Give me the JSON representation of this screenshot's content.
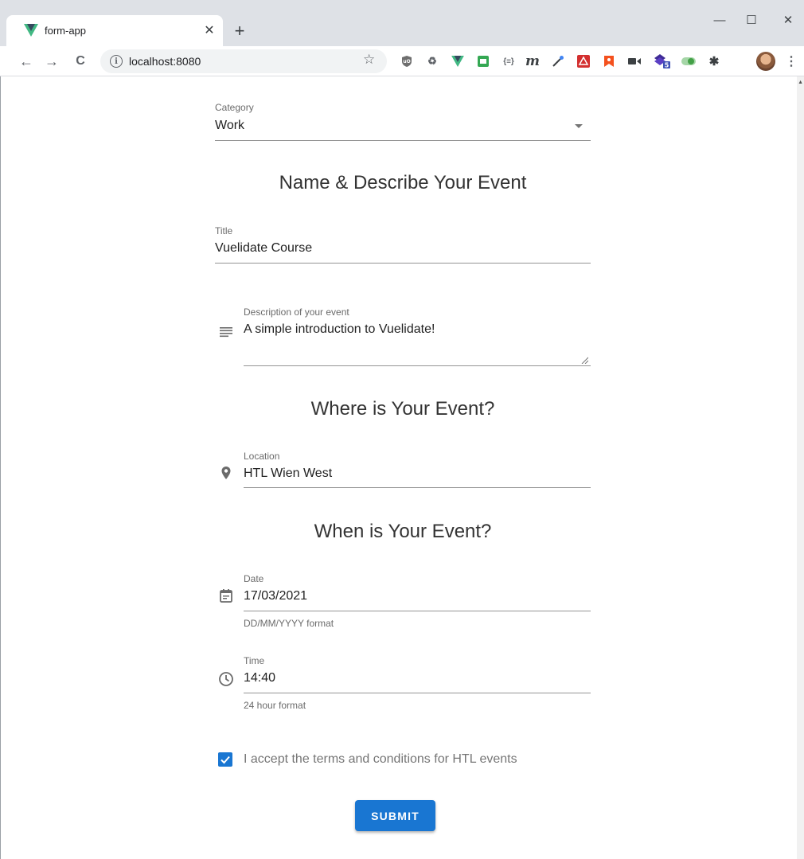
{
  "browser": {
    "tab_title": "form-app",
    "tab_close": "✕",
    "new_tab": "+",
    "minimize": "—",
    "maximize": "☐",
    "close": "✕",
    "back": "←",
    "forward": "→",
    "reload": "C",
    "url": "localhost:8080",
    "info_glyph": "i",
    "star": "☆",
    "menu": "⋮",
    "extension_icons": [
      "ublock-origin-icon",
      "recycle-icon",
      "vue-devtools-icon",
      "printer-icon",
      "json-icon",
      "m-icon",
      "eyedropper-icon",
      "acrobat-icon",
      "bookmark-icon",
      "video-icon",
      "stack-icon",
      "toggle-icon",
      "puzzle-icon"
    ]
  },
  "form": {
    "category": {
      "label": "Category",
      "value": "Work"
    },
    "section_name": "Name & Describe Your Event",
    "title": {
      "label": "Title",
      "value": "Vuelidate Course"
    },
    "description": {
      "label": "Description of your event",
      "value": "A simple introduction to Vuelidate!"
    },
    "section_where": "Where is Your Event?",
    "location": {
      "label": "Location",
      "value": "HTL Wien West"
    },
    "section_when": "When is Your Event?",
    "date": {
      "label": "Date",
      "value": "17/03/2021",
      "hint": "DD/MM/YYYY format"
    },
    "time": {
      "label": "Time",
      "value": "14:40",
      "hint": "24 hour format"
    },
    "terms": {
      "label": "I accept the terms and conditions for HTL events",
      "checked": true
    },
    "submit_label": "SUBMIT"
  },
  "colors": {
    "primary": "#1976d2",
    "vue_green": "#41b883",
    "vue_dark": "#35495e"
  }
}
